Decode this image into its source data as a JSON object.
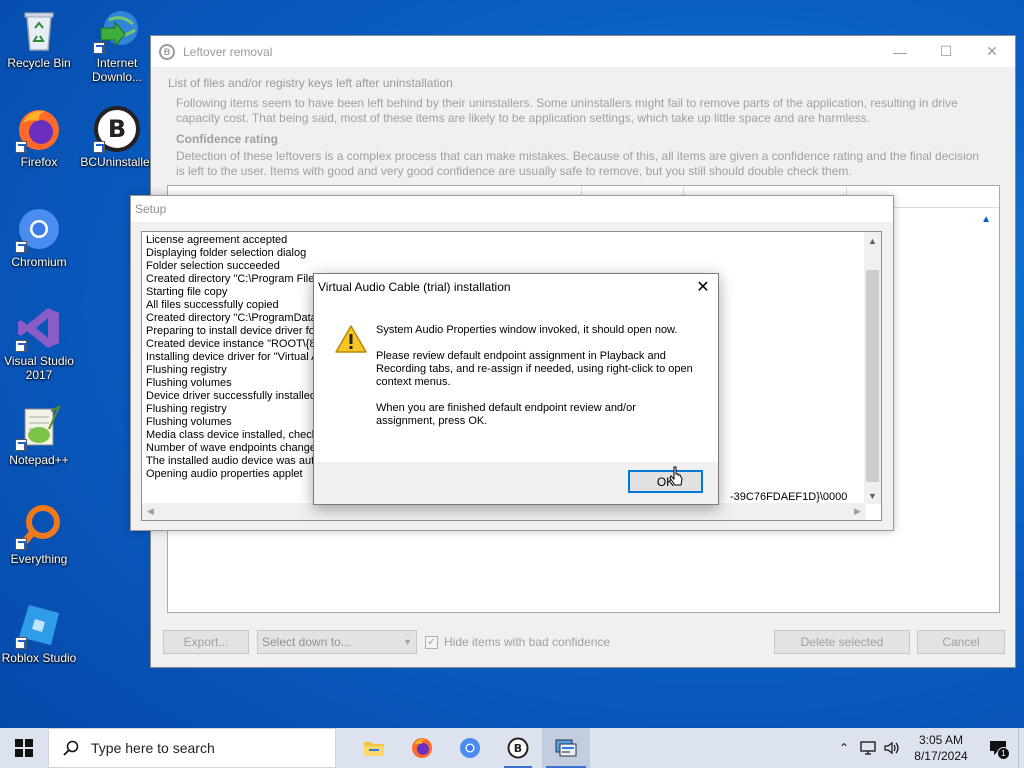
{
  "desktop": {
    "icons": [
      {
        "label": "Recycle Bin",
        "icon": "recycle-bin-icon"
      },
      {
        "label": "Internet Downlo...",
        "icon": "internet-download-manager-icon"
      },
      {
        "label": "Firefox",
        "icon": "firefox-icon"
      },
      {
        "label": "BCUninstaller",
        "icon": "bcuninstaller-icon"
      },
      {
        "label": "Chromium",
        "icon": "chromium-icon"
      },
      {
        "label": "Visual Studio 2017",
        "icon": "visual-studio-icon"
      },
      {
        "label": "Notepad++",
        "icon": "notepadpp-icon"
      },
      {
        "label": "Everything",
        "icon": "everything-icon"
      },
      {
        "label": "Roblox Studio",
        "icon": "roblox-studio-icon"
      }
    ]
  },
  "bcu": {
    "title": "Leftover removal",
    "group_title": "List of files and/or registry keys left after uninstallation",
    "intro": "Following items seem to have been left behind by their uninstallers. Some uninstallers might fail to remove parts of the application, resulting in drive capacity cost. That being said, most of these items are likely to be application settings, which take up little space and are harmless.",
    "confidence_heading": "Confidence rating",
    "confidence_text": "Detection of these leftovers is a complex process that can make mistakes. Because of this, all items are given a confidence rating and the final decision is left to the user. Items with good and very good confidence are usually safe to remove, but you still should double check them.",
    "export_label": "Export...",
    "select_placeholder": "Select down to...",
    "hide_bad_label": "Hide items with bad confidence",
    "delete_label": "Delete selected",
    "cancel_label": "Cancel"
  },
  "setup": {
    "title": "Setup",
    "log": [
      "License agreement accepted",
      "Displaying folder selection dialog",
      "Folder selection succeeded",
      "Created directory \"C:\\Program Files",
      "Starting file copy",
      "All files successfully copied",
      "Created directory \"C:\\ProgramData",
      "Preparing to install device driver fo",
      "Created device instance \"ROOT\\{8",
      "Installing device driver for \"Virtual A",
      "Flushing registry",
      "Flushing volumes",
      "Device driver successfully installed",
      "Flushing registry",
      "Flushing volumes",
      "Media class device installed, checkin",
      "Number of wave endpoints change",
      "The installed audio device was auto",
      "Opening audio properties applet"
    ],
    "log_tail": "-39C76FDAEF1D}\\0000"
  },
  "dialog": {
    "title": "Virtual Audio Cable (trial) installation",
    "paragraphs": [
      "System Audio Properties window invoked, it should open now.",
      "Please review default endpoint assignment in Playback and Recording tabs, and re-assign if needed, using right-click to open context menus.",
      "When you are finished default endpoint review and/or assignment, press OK."
    ],
    "ok_label": "OK"
  },
  "taskbar": {
    "search_placeholder": "Type here to search",
    "apps": [
      "file-explorer-icon",
      "firefox-icon",
      "chromium-icon",
      "bcuninstaller-icon",
      "setup-app-icon"
    ],
    "time": "3:05 AM",
    "date": "8/17/2024",
    "notification_count": "1"
  }
}
